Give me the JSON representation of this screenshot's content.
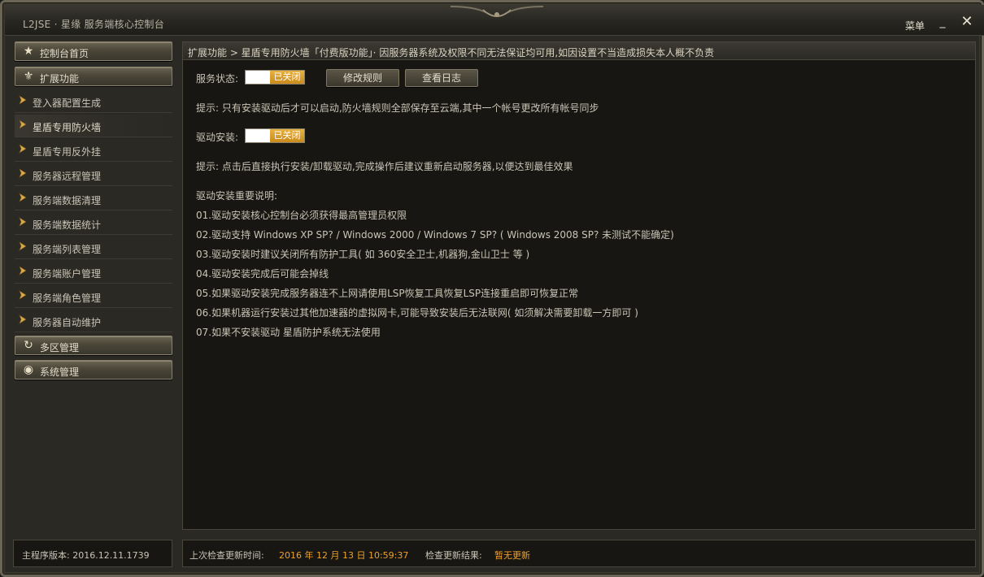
{
  "window": {
    "title": "L2JSE · 星缘 服务端核心控制台",
    "menu_label": "菜单",
    "minimize": "_",
    "close": "✕"
  },
  "sidebar": {
    "home": {
      "label": "控制台首页",
      "icon": "star-icon"
    },
    "extensions": {
      "label": "扩展功能",
      "icon": "fleur-icon"
    },
    "items": [
      {
        "label": "登入器配置生成"
      },
      {
        "label": "星盾专用防火墙"
      },
      {
        "label": "星盾专用反外挂"
      },
      {
        "label": "服务器远程管理"
      },
      {
        "label": "服务端数据清理"
      },
      {
        "label": "服务端数据统计"
      },
      {
        "label": "服务端列表管理"
      },
      {
        "label": "服务端账户管理"
      },
      {
        "label": "服务端角色管理"
      },
      {
        "label": "服务器自动维护"
      }
    ],
    "active_index": 1,
    "multizone": {
      "label": "多区管理",
      "icon": "refresh-icon"
    },
    "system": {
      "label": "系统管理",
      "icon": "eye-icon"
    }
  },
  "main": {
    "breadcrumb": "扩展功能 > 星盾专用防火墙「付费版功能」· 因服务器系统及权限不同无法保证均可用,如因设置不当造成损失本人概不负责",
    "service_status": {
      "label": "服务状态:",
      "state": "已关闭"
    },
    "buttons": {
      "modify_rules": "修改规则",
      "view_logs": "查看日志"
    },
    "hint1": "提示: 只有安装驱动后才可以启动,防火墙规则全部保存至云端,其中一个帐号更改所有帐号同步",
    "driver_install": {
      "label": "驱动安装:",
      "state": "已关闭"
    },
    "hint2": "提示: 点击后直接执行安装/卸载驱动,完成操作后建议重新启动服务器,以便达到最佳效果",
    "notes_title": "驱动安装重要说明:",
    "notes": [
      "01.驱动安装核心控制台必须获得最高管理员权限",
      "02.驱动支持 Windows XP SP? / Windows 2000 / Windows 7 SP? ( Windows 2008 SP? 未测试不能确定)",
      "03.驱动安装时建议关闭所有防护工具( 如 360安全卫士,机器狗,金山卫士 等 )",
      "04.驱动安装完成后可能会掉线",
      "05.如果驱动安装完成服务器连不上网请使用LSP恢复工具恢复LSP连接重启即可恢复正常",
      "06.如果机器运行安装过其他加速器的虚拟网卡,可能导致安装后无法联网( 如须解决需要卸载一方即可 )",
      "07.如果不安装驱动 星盾防护系统无法使用"
    ]
  },
  "footer": {
    "version": "主程序版本: 2016.12.11.1739",
    "last_check_label": "上次检查更新时间:",
    "last_check_value": "2016 年 12 月 13 日 10:59:37",
    "result_label": "检查更新结果:",
    "result_value": "暂无更新"
  },
  "colors": {
    "accent": "#f0a02a",
    "toggle": "#d99a22",
    "background": "#171612",
    "frame": "#2a2924"
  }
}
